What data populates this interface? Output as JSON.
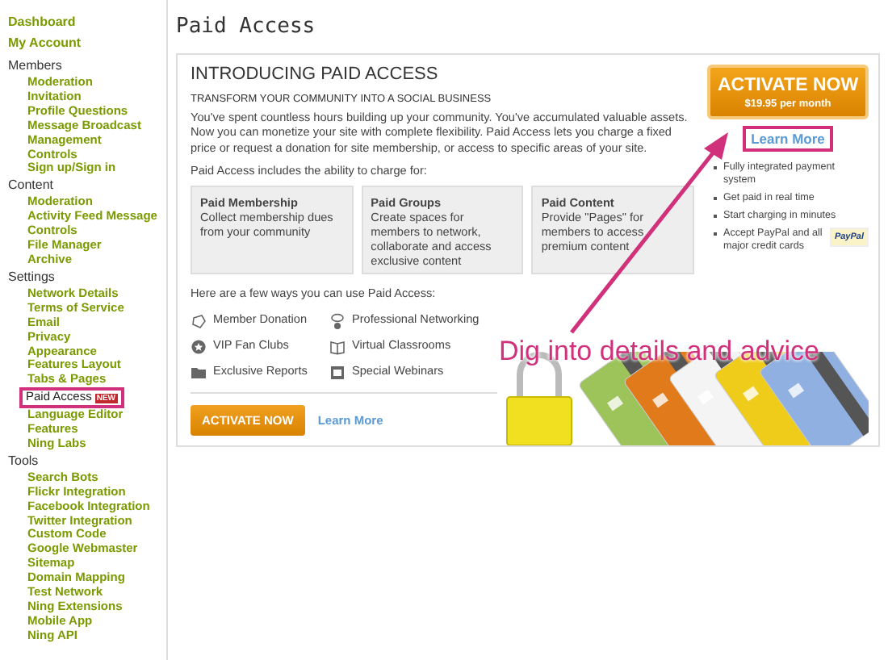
{
  "sidebar": {
    "sections": [
      {
        "heading": "Dashboard",
        "kind": "link"
      },
      {
        "heading": "My Account",
        "kind": "link"
      },
      {
        "heading": "Members",
        "kind": "group",
        "items": [
          {
            "label": "Moderation",
            "selected": false
          },
          {
            "label": "Invitation",
            "selected": false
          },
          {
            "label": "Profile Questions",
            "selected": false
          },
          {
            "label": "Message Broadcast",
            "selected": false
          },
          {
            "label": "Management",
            "selected": false
          },
          {
            "label": "Controls",
            "selected": false
          },
          {
            "label": "Sign up/Sign in",
            "selected": false
          }
        ]
      },
      {
        "heading": "Content",
        "kind": "group",
        "items": [
          {
            "label": "Moderation",
            "selected": false
          },
          {
            "label": "Activity Feed Message",
            "selected": false
          },
          {
            "label": "Controls",
            "selected": false
          },
          {
            "label": "File Manager",
            "selected": false
          },
          {
            "label": "Archive",
            "selected": false
          }
        ]
      },
      {
        "heading": "Settings",
        "kind": "group",
        "items": [
          {
            "label": "Network Details",
            "selected": false
          },
          {
            "label": "Terms of Service",
            "selected": false
          },
          {
            "label": "Email",
            "selected": false
          },
          {
            "label": "Privacy",
            "selected": false
          },
          {
            "label": "Appearance",
            "selected": false
          },
          {
            "label": "Features Layout",
            "selected": false
          },
          {
            "label": "Tabs & Pages",
            "selected": false
          },
          {
            "label": "Paid Access",
            "selected": true,
            "badge": "NEW"
          },
          {
            "label": "Language Editor",
            "selected": false
          },
          {
            "label": "Features",
            "selected": false
          },
          {
            "label": "Ning Labs",
            "selected": false
          }
        ]
      },
      {
        "heading": "Tools",
        "kind": "group",
        "items": [
          {
            "label": "Search Bots",
            "selected": false
          },
          {
            "label": "Flickr Integration",
            "selected": false
          },
          {
            "label": "Facebook Integration",
            "selected": false
          },
          {
            "label": "Twitter Integration",
            "selected": false
          },
          {
            "label": "Custom Code",
            "selected": false
          },
          {
            "label": "Google Webmaster",
            "selected": false
          },
          {
            "label": "Sitemap",
            "selected": false
          },
          {
            "label": "Domain Mapping",
            "selected": false
          },
          {
            "label": "Test Network",
            "selected": false
          },
          {
            "label": "Ning Extensions",
            "selected": false
          },
          {
            "label": "Mobile App",
            "selected": false
          },
          {
            "label": "Ning API",
            "selected": false
          }
        ]
      }
    ]
  },
  "page_title": "Paid Access",
  "panel": {
    "heading": "INTRODUCING PAID ACCESS",
    "subheading": "TRANSFORM YOUR COMMUNITY INTO A SOCIAL BUSINESS",
    "intro": "You've spent countless hours building up your community. You've accumulated valuable assets. Now you can monetize your site with complete flexibility. Paid Access lets you charge a fixed price or request a donation for site membership, or access to specific areas of your site.",
    "charge_intro": "Paid Access includes the ability to charge for:",
    "features": [
      {
        "title": "Paid Membership",
        "text": "Collect membership dues from your community"
      },
      {
        "title": "Paid Groups",
        "text": "Create spaces for members to network, collaborate and access exclusive content"
      },
      {
        "title": "Paid Content",
        "text": "Provide \"Pages\" for members to access premium content"
      }
    ],
    "ways_intro": "Here are a few ways you can use Paid Access:",
    "ways": [
      {
        "label": "Member Donation",
        "kind": "donation"
      },
      {
        "label": "Professional Networking",
        "kind": "networking"
      },
      {
        "label": "VIP Fan Clubs",
        "kind": "club"
      },
      {
        "label": "Virtual Classrooms",
        "kind": "classroom"
      },
      {
        "label": "Exclusive Reports",
        "kind": "reports"
      },
      {
        "label": "Special Webinars",
        "kind": "webinar"
      }
    ],
    "activate": {
      "label": "ACTIVATE NOW",
      "price": "$19.95 per month"
    },
    "learn_more": "Learn More",
    "benefits": [
      "Fully integrated payment system",
      "Get paid in real time",
      "Start charging in minutes",
      "Accept PayPal and all major credit cards"
    ],
    "paypal_badge": "PayPal",
    "footer_button": "ACTIVATE NOW",
    "footer_link": "Learn More"
  },
  "annotation": {
    "text": "Dig into details and advice"
  }
}
